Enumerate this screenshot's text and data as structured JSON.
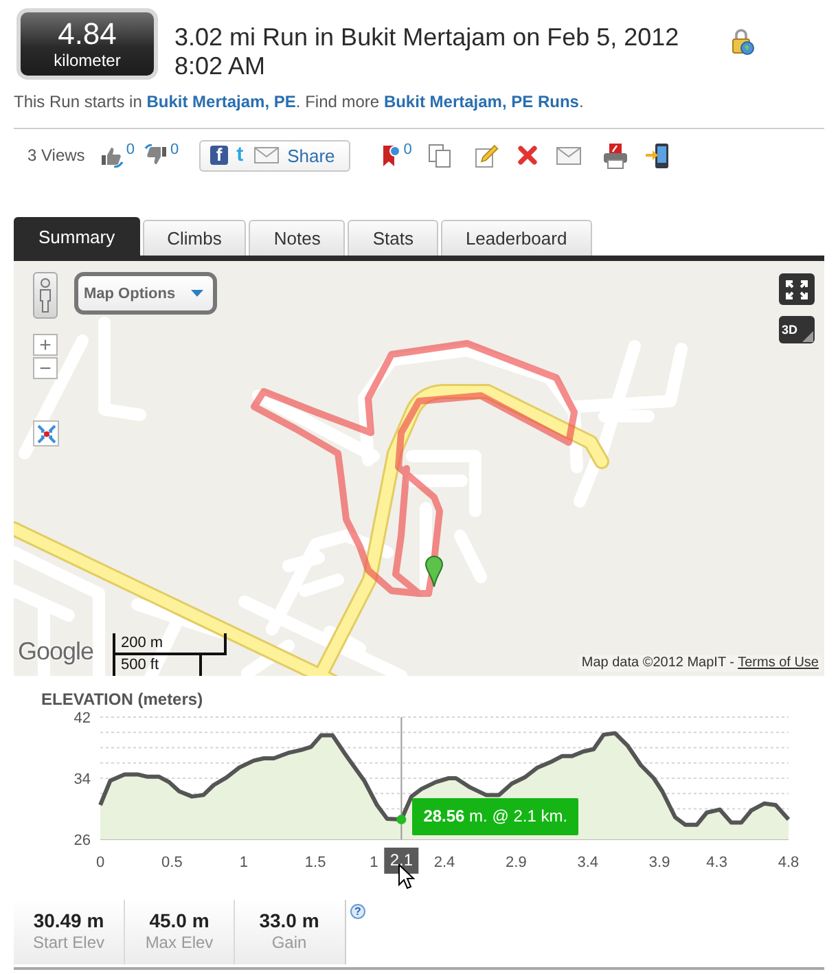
{
  "header": {
    "distance": {
      "value": "4.84",
      "unit": "kilometer"
    },
    "title": "3.02 mi Run in Bukit Mertajam on Feb 5, 2012 8:02 AM",
    "intro": [
      {
        "kind": "text",
        "text": "This Run starts in "
      },
      {
        "kind": "link",
        "text": "Bukit Mertajam, PE"
      },
      {
        "kind": "text",
        "text": ". Find more "
      },
      {
        "kind": "link",
        "text": "Bukit Mertajam, PE Runs"
      },
      {
        "kind": "text",
        "text": "."
      }
    ]
  },
  "actions": {
    "views": "3 Views",
    "like_count": "0",
    "dislike_count": "0",
    "share": {
      "logos": [
        "f",
        "t"
      ],
      "label": "Share"
    },
    "bookmark_count": "0"
  },
  "tabs": [
    {
      "label": "Summary",
      "selected": true
    },
    {
      "label": "Climbs",
      "selected": false
    },
    {
      "label": "Notes",
      "selected": false
    },
    {
      "label": "Stats",
      "selected": false
    },
    {
      "label": "Leaderboard",
      "selected": false
    }
  ],
  "map": {
    "options_label": "Map Options",
    "zoom_in": "+",
    "zoom_out": "−",
    "view_3d": "3D",
    "logo": "Google",
    "scale": {
      "metric": "200 m",
      "imperial": "500 ft"
    },
    "attribution": [
      {
        "kind": "text",
        "text": "Map data ©2012 MapIT - "
      },
      {
        "kind": "link",
        "text": "Terms of Use"
      }
    ]
  },
  "elevation": {
    "chart_data": {
      "type": "area",
      "title": "ELEVATION (meters)",
      "x": [
        0,
        0.07,
        0.17,
        0.26,
        0.33,
        0.41,
        0.48,
        0.55,
        0.64,
        0.72,
        0.79,
        0.88,
        0.97,
        1.07,
        1.14,
        1.21,
        1.31,
        1.4,
        1.47,
        1.54,
        1.62,
        1.71,
        1.84,
        1.93,
        2.0,
        2.1,
        2.17,
        2.24,
        2.34,
        2.43,
        2.48,
        2.58,
        2.69,
        2.78,
        2.87,
        2.96,
        3.05,
        3.14,
        3.22,
        3.29,
        3.37,
        3.44,
        3.51,
        3.59,
        3.68,
        3.77,
        3.86,
        3.92,
        4.01,
        4.08,
        4.16,
        4.23,
        4.32,
        4.4,
        4.47,
        4.54,
        4.63,
        4.71,
        4.8
      ],
      "values": [
        30.5,
        33.7,
        34.5,
        34.5,
        34.2,
        34.2,
        33.5,
        32.3,
        31.6,
        31.8,
        33.1,
        34.1,
        35.4,
        36.3,
        36.6,
        36.6,
        37.3,
        37.7,
        38.1,
        39.6,
        39.6,
        37.1,
        33.7,
        30.5,
        28.7,
        28.6,
        31.6,
        32.6,
        33.5,
        34.0,
        34.0,
        32.8,
        31.8,
        31.8,
        33.3,
        34.1,
        35.4,
        36.1,
        36.9,
        36.9,
        37.5,
        37.8,
        39.7,
        39.9,
        38.2,
        35.7,
        34.0,
        32.3,
        28.9,
        27.9,
        27.9,
        29.5,
        29.9,
        28.2,
        28.2,
        29.8,
        30.7,
        30.5,
        28.6
      ],
      "xlim": [
        0,
        4.8
      ],
      "ylim": [
        26,
        42
      ],
      "yticks": [
        26,
        34,
        42
      ],
      "xticks": [
        0,
        0.5,
        1,
        1.5,
        2.4,
        2.9,
        3.4,
        3.9,
        4.3,
        4.8
      ],
      "ref_lines": [
        {
          "axis": "x",
          "value": 2.1
        }
      ],
      "annotations": [
        {
          "x": 2.1,
          "y": 28.6,
          "text": "**28.56** m. @ 2.1 km."
        }
      ]
    },
    "cursor_label": "2.1",
    "covered_tick_label": "1",
    "stats": [
      {
        "value": "30.49 m",
        "label": "Start Elev"
      },
      {
        "value": "45.0 m",
        "label": "Max Elev"
      },
      {
        "value": "33.0 m",
        "label": "Gain"
      }
    ],
    "help": "?"
  }
}
